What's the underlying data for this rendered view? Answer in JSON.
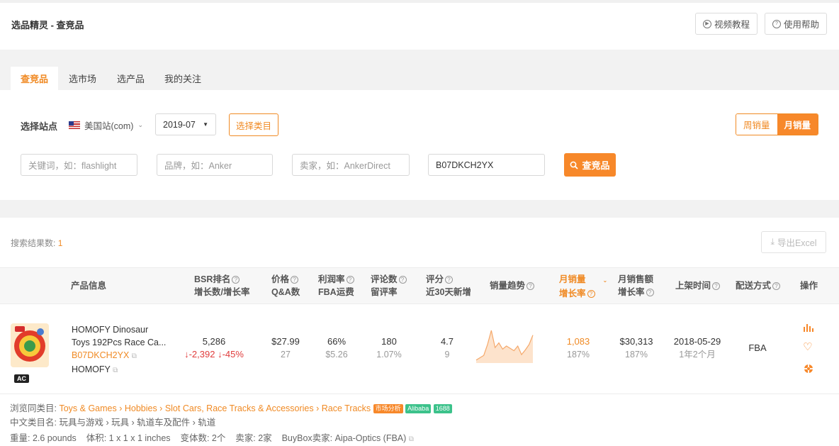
{
  "header": {
    "title": "选品精灵 - 查竞品",
    "video_btn": "视频教程",
    "help_btn": "使用帮助"
  },
  "tabs": [
    "查竞品",
    "选市场",
    "选产品",
    "我的关注"
  ],
  "filters": {
    "site_label": "选择站点",
    "site_value": "美国站(com)",
    "month_value": "2019-07",
    "category_btn": "选择类目",
    "keyword_placeholder": "关键词，如：flashlight",
    "brand_placeholder": "品牌，如：Anker",
    "seller_placeholder": "卖家，如：AnkerDirect",
    "asin_value": "B07DKCH2YX",
    "search_btn": "查竞品",
    "weekly": "周销量",
    "monthly": "月销量"
  },
  "results": {
    "count_label": "搜索结果数:",
    "count": "1",
    "export_btn": "导出Excel"
  },
  "columns": {
    "product": "产品信息",
    "bsr1": "BSR排名",
    "bsr2": "增长数/增长率",
    "price1": "价格",
    "price2": "Q&A数",
    "profit1": "利润率",
    "profit2": "FBA运费",
    "review1": "评论数",
    "review2": "留评率",
    "rating1": "评分",
    "rating2": "近30天新增",
    "trend": "销量趋势",
    "msales1": "月销量",
    "msales2": "增长率",
    "mrev1": "月销售额",
    "mrev2": "增长率",
    "listed": "上架时间",
    "ship": "配送方式",
    "ops": "操作"
  },
  "row": {
    "badge": "AC",
    "title1": "HOMOFY Dinosaur",
    "title2": "Toys 192Pcs Race Ca...",
    "asin": "B07DKCH2YX",
    "brand": "HOMOFY",
    "bsr": "5,286",
    "bsr_change": "-2,392",
    "bsr_rate": "-45%",
    "price": "$27.99",
    "qa": "27",
    "profit": "66%",
    "fba": "$5.26",
    "reviews": "180",
    "review_rate": "1.07%",
    "rating": "4.7",
    "new30": "9",
    "msales": "1,083",
    "msales_rate": "187%",
    "mrev": "$30,313",
    "mrev_rate": "187%",
    "listed_date": "2018-05-29",
    "listed_age": "1年2个月",
    "ship": "FBA",
    "trend": [
      2,
      5,
      8,
      22,
      40,
      18,
      24,
      16,
      20,
      17,
      14,
      20,
      9,
      15,
      22,
      34
    ]
  },
  "footer": {
    "browse_label": "浏览同类目:",
    "browse_path": "Toys & Games › Hobbies › Slot Cars, Race Tracks & Accessories › Race Tracks",
    "tag_market": "市场分析",
    "tag_alibaba": "Alibaba",
    "tag_1688": "1688",
    "cn_label": "中文类目名:",
    "cn_path": "玩具与游戏 › 玩具 › 轨道车及配件 › 轨道",
    "weight": "重量: 2.6 pounds",
    "volume": "体积: 1 x 1 x 1 inches",
    "variants": "变体数: 2个",
    "sellers": "卖家: 2家",
    "buybox": "BuyBox卖家: Aipa-Optics (FBA)"
  },
  "colors": {
    "accent": "#f7882a",
    "down": "#e03c3c"
  }
}
